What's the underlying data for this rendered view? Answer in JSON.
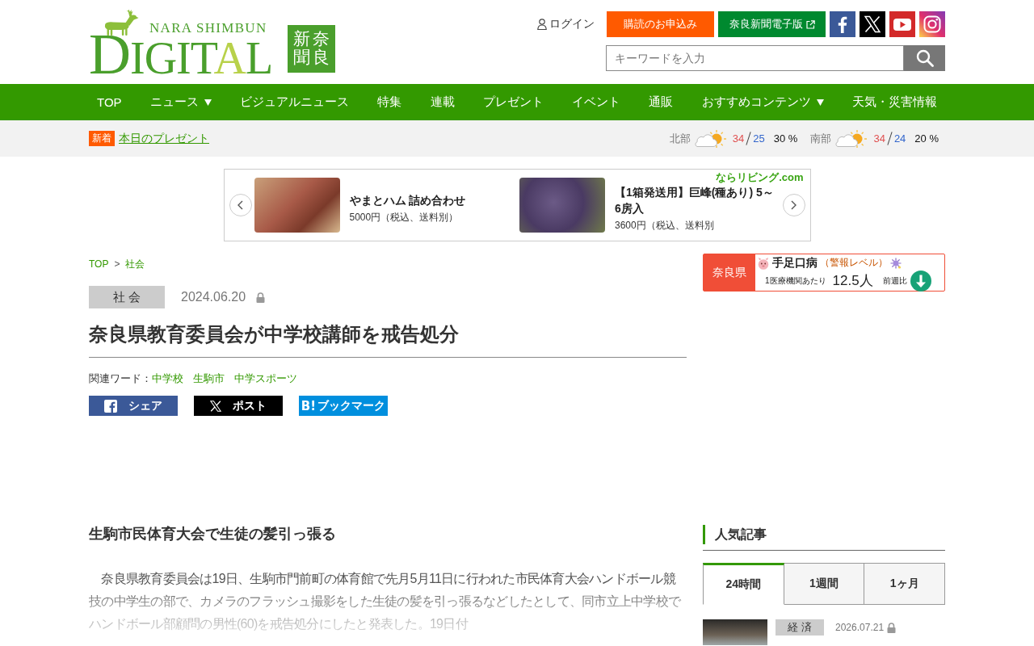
{
  "header": {
    "logo": {
      "tagline": "NARA SHIMBUN",
      "wordmark": "DIGITAL",
      "emblem": "奈良新聞"
    },
    "login": {
      "label": "ログイン"
    },
    "buttons": [
      {
        "kind": "subscribe",
        "label": "購読のお申込み",
        "external": false
      },
      {
        "kind": "edition",
        "label": "奈良新聞電子版",
        "external": true
      }
    ],
    "social": [
      {
        "kind": "facebook"
      },
      {
        "kind": "x"
      },
      {
        "kind": "youtube"
      },
      {
        "kind": "instagram"
      }
    ],
    "search": {
      "placeholder": "キーワードを入力"
    }
  },
  "nav": [
    {
      "label": "TOP",
      "has_menu": false
    },
    {
      "label": "ニュース",
      "has_menu": true
    },
    {
      "label": "ビジュアルニュース",
      "has_menu": false
    },
    {
      "label": "特集",
      "has_menu": false
    },
    {
      "label": "連載",
      "has_menu": false
    },
    {
      "label": "プレゼント",
      "has_menu": false
    },
    {
      "label": "イベント",
      "has_menu": false
    },
    {
      "label": "通販",
      "has_menu": false
    },
    {
      "label": "おすすめコンテンツ",
      "has_menu": true
    },
    {
      "label": "天気・災害情報",
      "has_menu": false
    }
  ],
  "ticker": {
    "badge": "新着",
    "link": "本日のプレゼント"
  },
  "weather": [
    {
      "region": "北部",
      "high": "34",
      "low": "25",
      "rain": "30 %"
    },
    {
      "region": "南部",
      "high": "34",
      "low": "24",
      "rain": "20 %"
    }
  ],
  "ad_carousel": {
    "brand": "ならリビング.com",
    "items": [
      {
        "title": "やまとハム 詰め合わせ",
        "price": "5000円（税込、送料別）"
      },
      {
        "title": "【1箱発送用】巨峰(種あり) 5～6房入",
        "price": "3600円（税込、送料別"
      }
    ]
  },
  "breadcrumb": {
    "items": [
      "TOP",
      "社会"
    ],
    "separator": ">"
  },
  "article": {
    "category": "社 会",
    "date": "2024.06.20",
    "locked": true,
    "title": "奈良県教育委員会が中学校講師を戒告処分",
    "related_label": "関連ワード：",
    "related": [
      "中学校",
      "生駒市",
      "中学スポーツ"
    ],
    "share": [
      {
        "kind": "facebook",
        "label": "シェア"
      },
      {
        "kind": "x",
        "label": "ポスト"
      },
      {
        "kind": "hatena",
        "mark": "B!",
        "label": "ブックマーク"
      }
    ],
    "subtitle": "生駒市民体育大会で生徒の髪引っ張る",
    "body": "　奈良県教育委員会は19日、生駒市門前町の体育館で先月5月11日に行われた市民体育大会ハンドボール競技の中学生の部で、カメラのフラッシュ撮影をした生徒の髪を引っ張るなどしたとして、同市立上中学校でハンドボール部顧問の男性(60)を戒告処分にしたと発表した。19日付"
  },
  "sidebar": {
    "alert": {
      "region": "奈良県",
      "disease": "手足口病",
      "level_label": "（警報レベル）",
      "per_label": "1医療機関あたり",
      "value": "12.5人",
      "compare_label": "前週比",
      "decreased": true
    },
    "popular": {
      "heading": "人気記事",
      "tabs": [
        {
          "label": "24時間",
          "selected": true
        },
        {
          "label": "1週間",
          "selected": false
        },
        {
          "label": "1ヶ月",
          "selected": false
        }
      ],
      "items": [
        {
          "category": "経 済",
          "date": "2026.07.21",
          "locked": true
        }
      ]
    }
  }
}
